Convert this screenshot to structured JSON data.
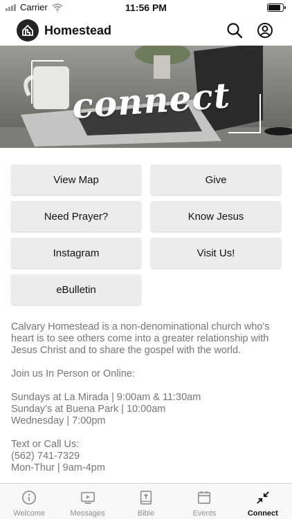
{
  "status_bar": {
    "carrier": "Carrier",
    "time": "11:56 PM",
    "battery_level": 0.95
  },
  "header": {
    "title": "Homestead",
    "icons": [
      "logo-icon",
      "search-icon",
      "account-icon"
    ]
  },
  "hero": {
    "title": "connect"
  },
  "buttons": [
    {
      "label": "View Map"
    },
    {
      "label": "Give"
    },
    {
      "label": "Need Prayer?"
    },
    {
      "label": "Know Jesus"
    },
    {
      "label": "Instagram"
    },
    {
      "label": "Visit Us!"
    },
    {
      "label": "eBulletin"
    }
  ],
  "description": {
    "intro": "Calvary Homestead is a non-denominational church who's heart is to see others come into a greater relationship with Jesus Christ and to share the gospel with the world.",
    "join": "Join us In Person or Online:",
    "service_1": "Sundays at La Mirada | 9:00am & 11:30am",
    "service_2": "Sunday's at Buena Park | 10:00am",
    "service_3": "Wednesday | 7:00pm",
    "contact_heading": "Text or Call Us:",
    "phone": "(562) 741-7329",
    "hours": "Mon-Thur | 9am-4pm"
  },
  "tabs": [
    {
      "label": "Welcome",
      "icon": "info-icon"
    },
    {
      "label": "Messages",
      "icon": "video-icon"
    },
    {
      "label": "Bible",
      "icon": "bible-icon"
    },
    {
      "label": "Events",
      "icon": "calendar-icon"
    },
    {
      "label": "Connect",
      "icon": "connect-icon",
      "active": true
    }
  ],
  "colors": {
    "accent": "#111111",
    "button_bg": "#ececef",
    "body_text": "#767676",
    "tab_inactive": "#8e8e93"
  }
}
